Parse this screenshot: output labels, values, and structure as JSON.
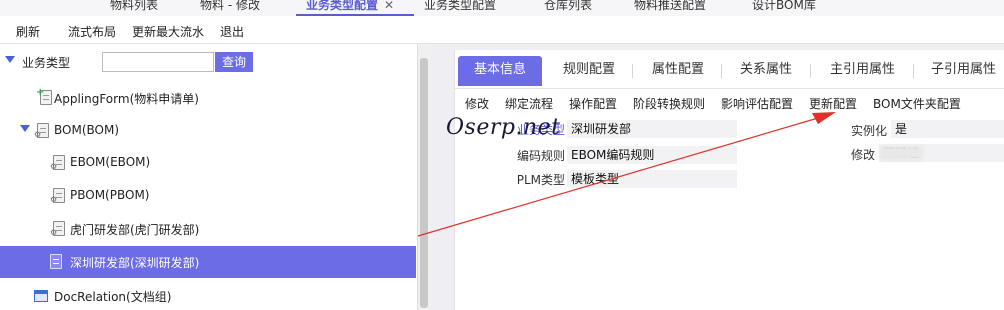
{
  "top_tabs": [
    {
      "label": "物料列表",
      "active": false
    },
    {
      "label": "物料 - 修改",
      "active": false
    },
    {
      "label": "业务类型配置",
      "active": true,
      "closable": true
    },
    {
      "label": "业务类型配置",
      "active": false
    },
    {
      "label": "仓库列表",
      "active": false
    },
    {
      "label": "物料推送配置",
      "active": false
    },
    {
      "label": "设计BOM库",
      "active": false
    }
  ],
  "toolbar": {
    "refresh": "刷新",
    "flow_layout": "流式布局",
    "update_max_serial": "更新最大流水",
    "exit": "退出"
  },
  "tree": {
    "root_label": "业务类型",
    "search_placeholder": "",
    "search_button": "查询",
    "items": [
      {
        "label": "ApplingForm(物料申请单)",
        "icon": "document-add-icon"
      },
      {
        "label": "BOM(BOM)",
        "icon": "document-gear-icon",
        "expanded": true
      },
      {
        "label": "EBOM(EBOM)",
        "icon": "document-gear-icon"
      },
      {
        "label": "PBOM(PBOM)",
        "icon": "document-gear-icon"
      },
      {
        "label": "虎门研发部(虎门研发部)",
        "icon": "document-gear-icon"
      },
      {
        "label": "深圳研发部(深圳研发部)",
        "icon": "document-icon",
        "selected": true
      },
      {
        "label": "DocRelation(文档组)",
        "icon": "window-icon"
      }
    ]
  },
  "panel_tabs": [
    "基本信息",
    "规则配置",
    "属性配置",
    "关系属性",
    "主引用属性",
    "子引用属性"
  ],
  "sub_actions": [
    "修改",
    "绑定流程",
    "操作配置",
    "阶段转换规则",
    "影响评估配置",
    "更新配置",
    "BOM文件夹配置"
  ],
  "fields": {
    "business_type_label": "业务类型",
    "business_type_value": "深圳研发部",
    "encoding_rule_label": "编码规则",
    "encoding_rule_value": "EBOM编码规则",
    "plm_type_label": "PLM类型",
    "plm_type_value": "模板类型",
    "instantiate_label": "实例化",
    "instantiate_value": "是",
    "modifier_label": "修改",
    "modifier_value_visible": "深研组"
  },
  "watermark": "Oserp.net",
  "colors": {
    "accent": "#6c6ce6",
    "arrow": "#e0302a"
  }
}
